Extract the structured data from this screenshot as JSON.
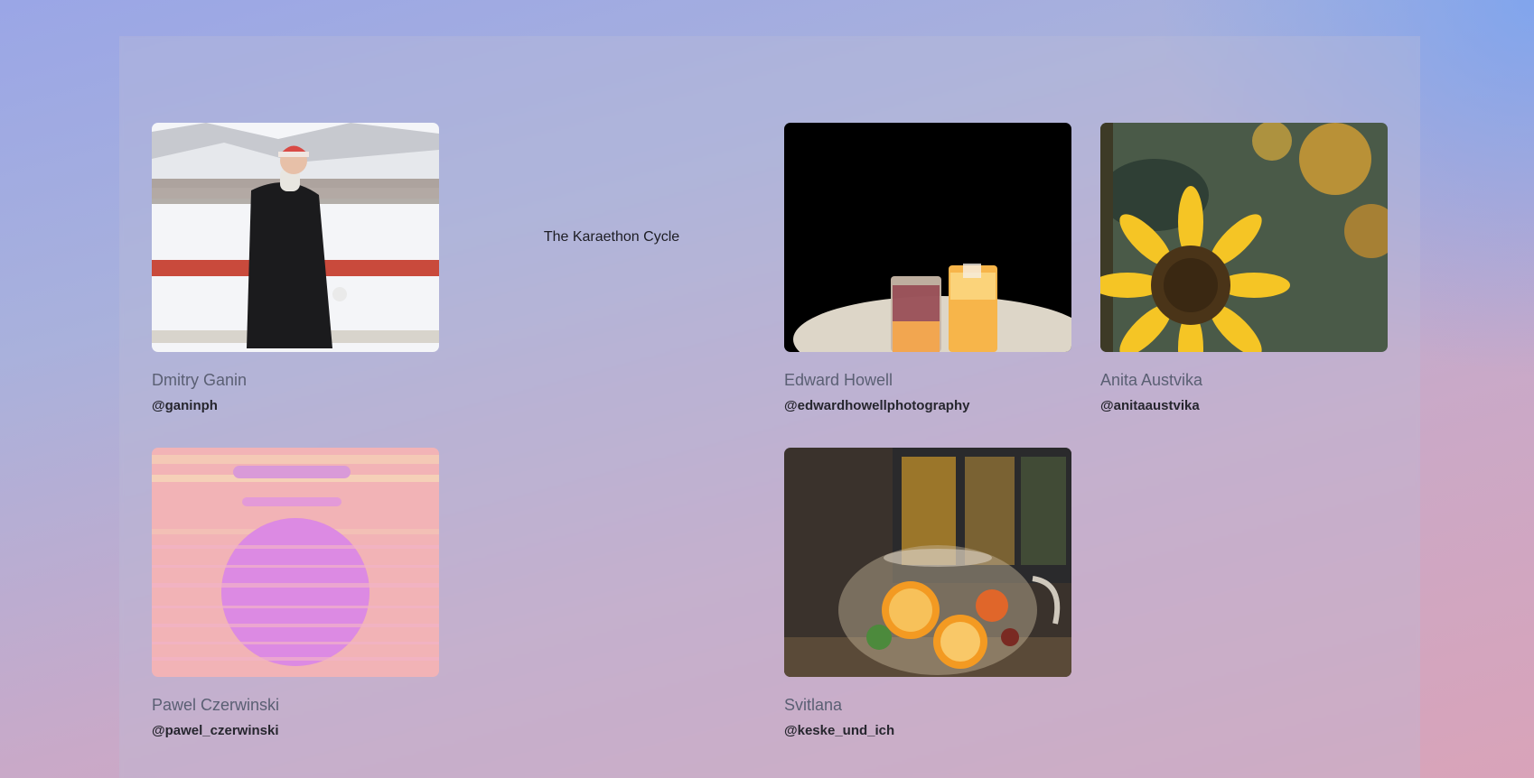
{
  "page": {
    "title": "The Karaethon Cycle"
  },
  "gallery": {
    "cards": [
      {
        "name": "Dmitry Ganin",
        "handle": "@ganinph",
        "image": "woman-in-snow-photo"
      },
      {
        "name": "Edward Howell",
        "handle": "@edwardhowellphotography",
        "image": "cocktails-photo"
      },
      {
        "name": "Anita Austvika",
        "handle": "@anitaaustvika",
        "image": "sunflower-photo"
      },
      {
        "name": "Pawel Czerwinski",
        "handle": "@pawel_czerwinski",
        "image": "glitch-sphere-art"
      },
      {
        "name": "Svitlana",
        "handle": "@keske_und_ich",
        "image": "fruit-tea-teapot-photo"
      }
    ]
  }
}
